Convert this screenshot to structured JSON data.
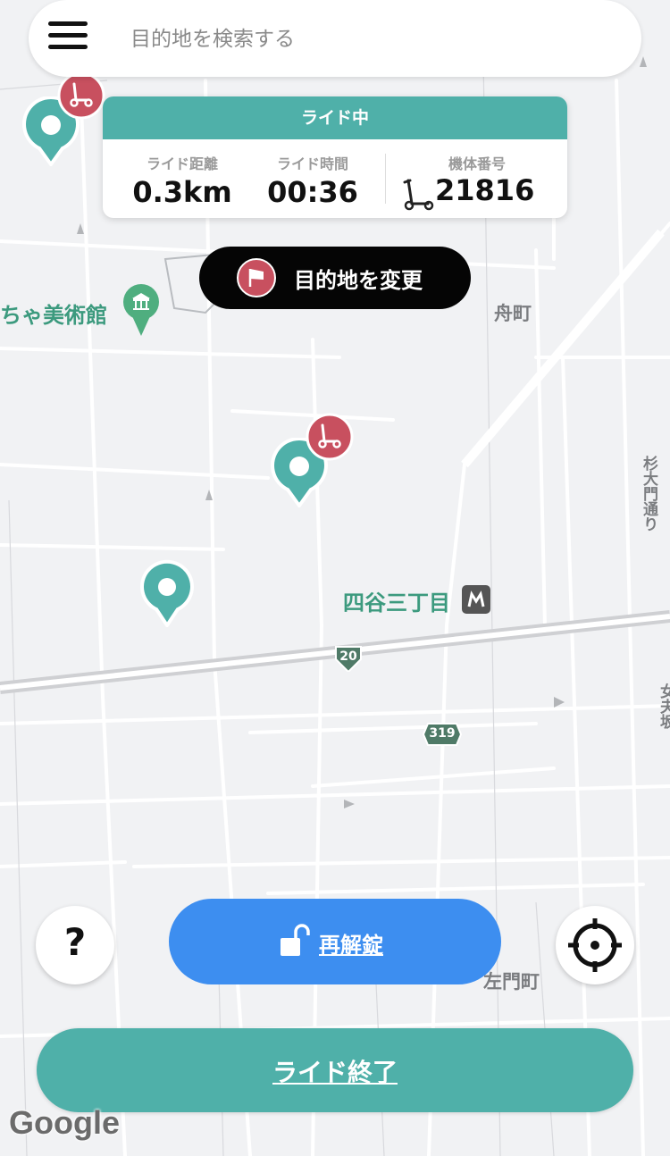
{
  "search": {
    "placeholder": "目的地を検索する"
  },
  "ride_card": {
    "header": "ライド中",
    "distance_label": "ライド距離",
    "distance_value": "0.3km",
    "time_label": "ライド時間",
    "time_value": "00:36",
    "vehicle_label": "機体番号",
    "vehicle_value": "21816"
  },
  "change_destination_label": "目的地を変更",
  "map": {
    "labels": {
      "museum": "ちゃ美術館",
      "funamachi": "舟町",
      "station": "四谷三丁目",
      "samon": "左門町",
      "sugi": "杉大門通り",
      "jochi": "女夫坂"
    },
    "route_20": "20",
    "route_319": "319"
  },
  "help_label": "?",
  "relock_label": "再解錠",
  "end_ride_label": "ライド終了",
  "google_logo": "Google",
  "colors": {
    "teal": "#4fb0a9",
    "scooter_red": "#c8505f",
    "blue": "#3d8ef0",
    "black": "#050505"
  }
}
